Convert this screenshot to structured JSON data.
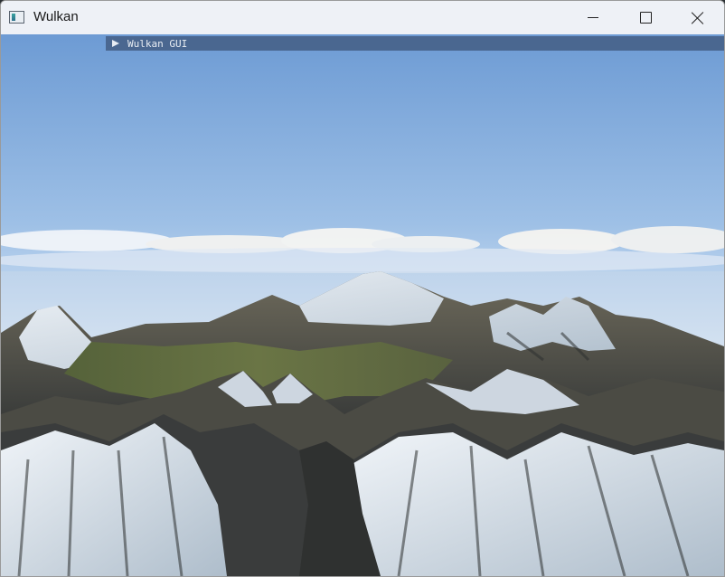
{
  "window": {
    "title": "Wulkan",
    "controls": {
      "minimize": "minimize-icon",
      "maximize": "maximize-icon",
      "close": "close-icon"
    }
  },
  "gui": {
    "panel_label": "Wulkan GUI",
    "collapsed": true,
    "header_color": "#4a6790"
  },
  "scene": {
    "sky_top": "#6e9bd3",
    "sky_horizon": "#e3edf6",
    "mountain_snow": "#d4dde6",
    "mountain_rock": "#3c3f3f",
    "valley_grass": "#5b6a37"
  }
}
